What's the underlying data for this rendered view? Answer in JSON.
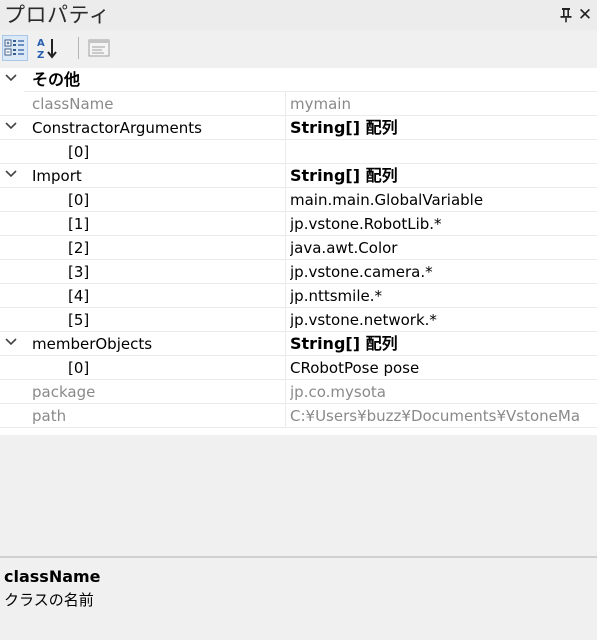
{
  "panel": {
    "title": "プロパティ",
    "pin_icon": "pin-icon",
    "close_icon": "close-icon"
  },
  "toolbar": {
    "categorized": "categorized-view-icon",
    "alphabetical": "sort-alphabetical-icon",
    "property_pages": "property-pages-icon"
  },
  "grid": {
    "category_label": "その他",
    "rows": {
      "className": {
        "name": "className",
        "value": "mymain"
      },
      "ctorArgs": {
        "name": "ConstractorArguments",
        "value": "String[] 配列"
      },
      "ctorArgs0": {
        "name": "[0]",
        "value": ""
      },
      "import": {
        "name": "Import",
        "value": "String[] 配列"
      },
      "import0": {
        "name": "[0]",
        "value": "main.main.GlobalVariable"
      },
      "import1": {
        "name": "[1]",
        "value": "jp.vstone.RobotLib.*"
      },
      "import2": {
        "name": "[2]",
        "value": "java.awt.Color"
      },
      "import3": {
        "name": "[3]",
        "value": "jp.vstone.camera.*"
      },
      "import4": {
        "name": "[4]",
        "value": "jp.nttsmile.*"
      },
      "import5": {
        "name": "[5]",
        "value": "jp.vstone.network.*"
      },
      "memberObjects": {
        "name": "memberObjects",
        "value": "String[] 配列"
      },
      "member0": {
        "name": "[0]",
        "value": "CRobotPose pose"
      },
      "package": {
        "name": "package",
        "value": "jp.co.mysota"
      },
      "path": {
        "name": "path",
        "value": "C:¥Users¥buzz¥Documents¥VstoneMa"
      }
    }
  },
  "description": {
    "title": "className",
    "text": "クラスの名前"
  }
}
